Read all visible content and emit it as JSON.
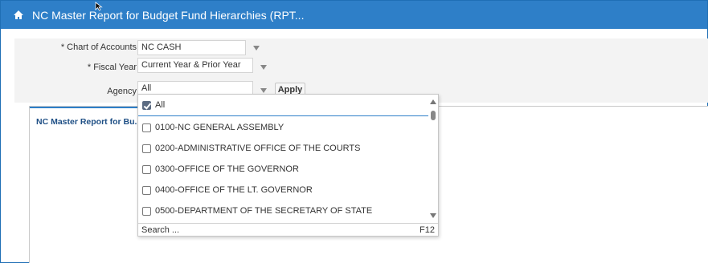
{
  "header": {
    "title": "NC Master Report for Budget Fund Hierarchies (RPT..."
  },
  "prompts": {
    "chart_of_accounts": {
      "required_marker": "*",
      "label": "Chart of Accounts",
      "value": "NC CASH"
    },
    "fiscal_year": {
      "required_marker": "*",
      "label": "Fiscal Year",
      "value": "Current Year & Prior Year"
    },
    "agency": {
      "label": "Agency",
      "value": "All"
    },
    "apply_label": "Apply"
  },
  "report": {
    "tab_label": "NC Master Report for Bu..."
  },
  "agency_dropdown": {
    "all_label": "All",
    "all_checked": true,
    "items": [
      {
        "label": "0100-NC GENERAL ASSEMBLY",
        "checked": false
      },
      {
        "label": "0200-ADMINISTRATIVE OFFICE OF THE COURTS",
        "checked": false
      },
      {
        "label": "0300-OFFICE OF THE GOVERNOR",
        "checked": false
      },
      {
        "label": "0400-OFFICE OF THE LT. GOVERNOR",
        "checked": false
      },
      {
        "label": "0500-DEPARTMENT OF THE SECRETARY OF STATE",
        "checked": false
      }
    ],
    "search_label": "Search ...",
    "search_shortcut": "F12"
  },
  "colors": {
    "header_bg": "#2e7fc8",
    "accent": "#2e7fc8",
    "tab_text": "#1e4f85"
  }
}
